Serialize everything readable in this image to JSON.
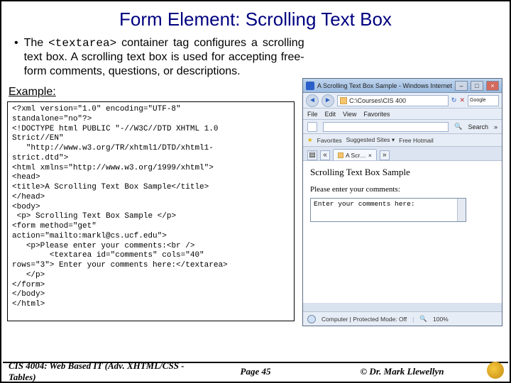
{
  "title": "Form Element: Scrolling Text Box",
  "bullet": {
    "pre": "The ",
    "tag": "<textarea>",
    "post": " container tag configures a scrolling text box.  A scrolling text box is used for accepting free-form comments, questions, or descriptions."
  },
  "example_label": "Example:",
  "code": "<?xml version=\"1.0\" encoding=\"UTF-8\"\nstandalone=\"no\"?>\n<!DOCTYPE html PUBLIC \"-//W3C//DTD XHTML 1.0\nStrict//EN\"\n   \"http://www.w3.org/TR/xhtml1/DTD/xhtml1-\nstrict.dtd\">\n<html xmlns=\"http://www.w3.org/1999/xhtml\">\n<head>\n<title>A Scrolling Text Box Sample</title>\n</head>\n<body>\n <p> Scrolling Text Box Sample </p>\n<form method=\"get\"\naction=\"mailto:markl@cs.ucf.edu\">\n   <p>Please enter your comments:<br />\n        <textarea id=\"comments\" cols=\"40\"\nrows=\"3\"> Enter your comments here:</textarea>\n   </p>\n</form>\n</body>\n</html>",
  "browser": {
    "window_title": "A Scrolling Text Box Sample - Windows Internet Explo…",
    "address_path": "C:\\Courses\\CIS 400",
    "menu": {
      "file": "File",
      "edit": "Edit",
      "view": "View",
      "favorites": "Favorites"
    },
    "favorites_label": "Favorites",
    "suggested": "Suggested Sites ▾",
    "hotmail": "Free Hotmail",
    "tab_label": "A Scr…",
    "page_header": "Scrolling Text Box Sample",
    "prompt": "Please enter your comments:",
    "textarea_value": "Enter your comments here:",
    "status_mode": "Computer | Protected Mode: Off",
    "zoom": "100%",
    "search_label": "Search",
    "google_label": "Google"
  },
  "footer": {
    "left": "CIS 4004: Web Based IT (Adv. XHTML/CSS - Tables)",
    "center": "Page 45",
    "right": "© Dr. Mark Llewellyn"
  }
}
